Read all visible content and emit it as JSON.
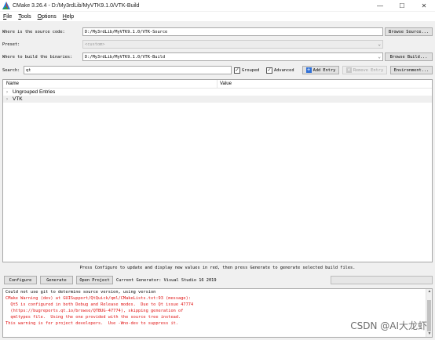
{
  "window": {
    "title": "CMake 3.26.4 - D:/My3rdLib/MyVTK9.1.0/VTK-Build",
    "minimize": "—",
    "maximize": "☐",
    "close": "✕"
  },
  "menu": {
    "items": [
      {
        "ul": "F",
        "rest": "ile"
      },
      {
        "ul": "T",
        "rest": "ools"
      },
      {
        "ul": "O",
        "rest": "ptions"
      },
      {
        "ul": "H",
        "rest": "elp"
      }
    ]
  },
  "source": {
    "label": "Where is the source code:",
    "value": "D:/My3rdLib/MyVTK9.1.0/VTK-Source",
    "browse": "Browse Source..."
  },
  "preset": {
    "label": "Preset:",
    "value": "<custom>"
  },
  "build": {
    "label": "Where to build the binaries:",
    "value": "D:/My3rdLib/MyVTK9.1.0/VTK-Build",
    "browse": "Browse Build..."
  },
  "search": {
    "label": "Search:",
    "value": "qt",
    "grouped": "Grouped",
    "advanced": "Advanced",
    "add": "Add Entry",
    "remove": "Remove Entry",
    "environment": "Environment..."
  },
  "tree": {
    "col_name": "Name",
    "col_value": "Value",
    "rows": [
      "Ungrouped Entries",
      "VTK"
    ]
  },
  "hint": "Press Configure to update and display new values in red, then press Generate to generate selected build files.",
  "actions": {
    "configure": "Configure",
    "generate": "Generate",
    "open_project": "Open Project",
    "generator": "Current Generator: Visual Studio 16 2019"
  },
  "output": [
    {
      "text": "Could not use git to determine source version, using version",
      "err": false
    },
    {
      "text": "CMake Warning (dev) at GUISupport/QtQuick/qml/CMakeLists.txt:93 (message):",
      "err": true
    },
    {
      "text": "  Qt5 is configured in both Debug and Release modes.  Due to Qt issue 47774",
      "err": true
    },
    {
      "text": "  (https://bugreports.qt.io/browse/QTBUG-47774), skipping generation of",
      "err": true
    },
    {
      "text": "  qmltypes file.  Using the one provided with the source tree instead.",
      "err": true
    },
    {
      "text": "This warning is for project developers.  Use -Wno-dev to suppress it.",
      "err": true
    }
  ],
  "watermark": "CSDN @AI大龙虾",
  "colors": {
    "error_text": "#e01010",
    "window_bg": "#f0f0f0"
  }
}
